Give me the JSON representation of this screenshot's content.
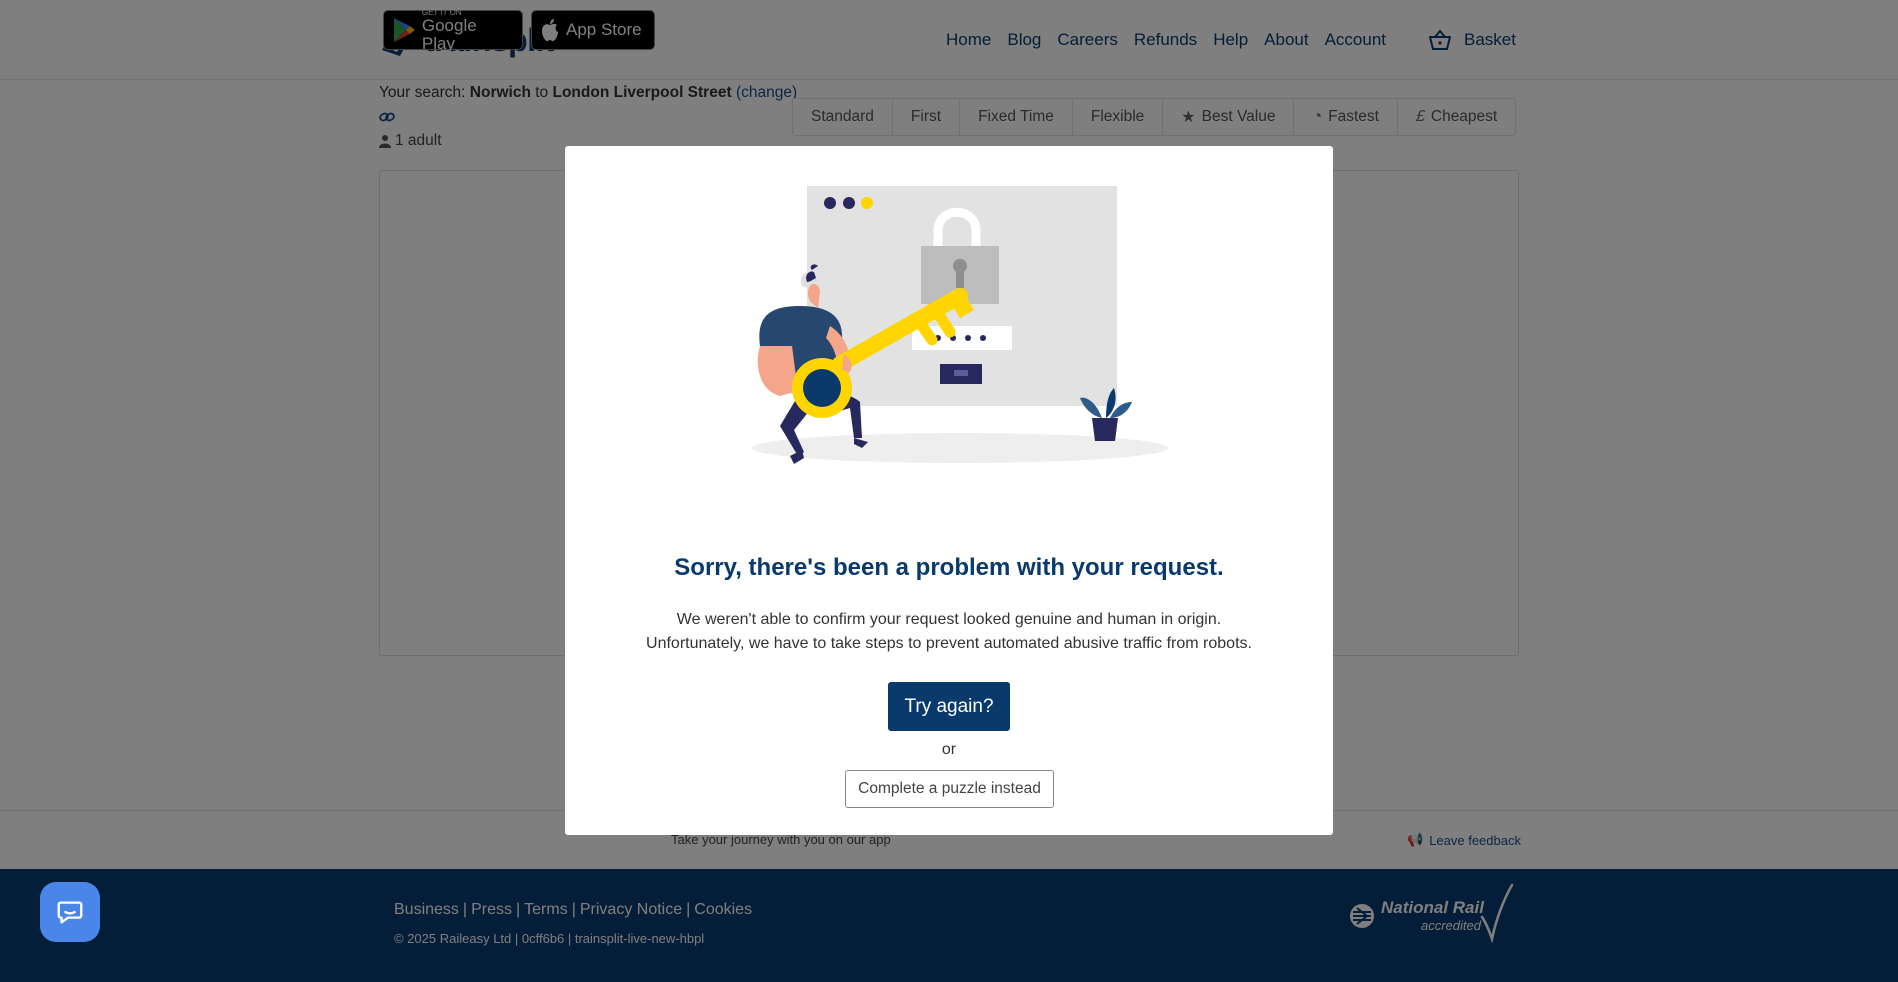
{
  "header": {
    "logo_text": "trainsplit",
    "nav": [
      "Home",
      "Blog",
      "Careers",
      "Refunds",
      "Help",
      "About",
      "Account"
    ],
    "basket_label": "Basket"
  },
  "search": {
    "prefix": "Your search:",
    "from": "Norwich",
    "to_word": "to",
    "to": "London Liverpool Street",
    "change_label": "(change)",
    "passengers": "1 adult"
  },
  "filters": [
    {
      "label": "Standard",
      "icon": ""
    },
    {
      "label": "First",
      "icon": ""
    },
    {
      "label": "Fixed Time",
      "icon": ""
    },
    {
      "label": "Flexible",
      "icon": ""
    },
    {
      "label": "Best Value",
      "icon": "star-icon"
    },
    {
      "label": "Fastest",
      "icon": "clock-icon"
    },
    {
      "label": "Cheapest",
      "icon": "pound-icon"
    }
  ],
  "app_strip": {
    "google_small": "GET IT ON",
    "google_big": "Google Play",
    "apple_big": "App Store",
    "tagline": "Take your journey with you on our app",
    "feedback": "Leave feedback"
  },
  "footer": {
    "links": [
      "Business",
      "Press",
      "Terms",
      "Privacy Notice",
      "Cookies"
    ],
    "copyright": "© 2025 Raileasy Ltd | 0cff6b6 | trainsplit-live-new-hbpl",
    "nr_title": "National Rail",
    "nr_sub": "accredited"
  },
  "modal": {
    "title": "Sorry, there's been a problem with your request.",
    "line1": "We weren't able to confirm your request looked genuine and human in origin.",
    "line2": "Unfortunately, we have to take steps to prevent automated abusive traffic from robots.",
    "try_again": "Try again?",
    "or": "or",
    "puzzle": "Complete a puzzle instead"
  },
  "colors": {
    "brand": "#0a3a6b",
    "footer": "#083a70",
    "key": "#ffd500",
    "chat": "#4a86e8"
  }
}
